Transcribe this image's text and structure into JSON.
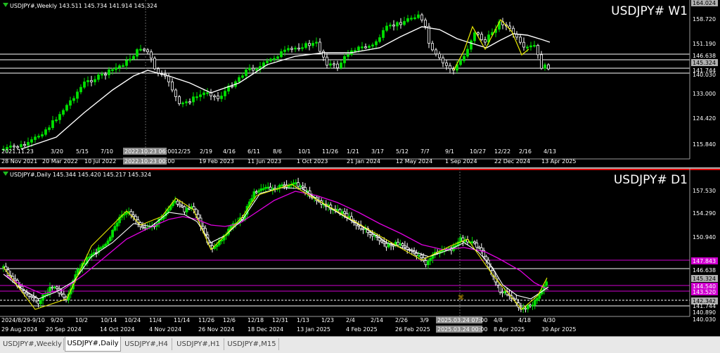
{
  "weekly": {
    "header": "USDJPY#,Weekly  143.511 145.734 141.914 145.324",
    "symbol_label": "USDJPY# W1",
    "price_labels": [
      "164.024",
      "158.720",
      "151.190",
      "146.638",
      "145.324",
      "141.744",
      "140.030",
      "133.000",
      "124.420",
      "115.840"
    ],
    "date_labels": [
      "2021.11.23",
      "28 Nov 2021",
      "3/20",
      "20 Mar 2022",
      "5/15",
      "7/10",
      "10 Jul 2022",
      "2022.10.23 06:00",
      "2022.10.23 00:00",
      "12/25",
      "2/19",
      "19 Feb 2023",
      "4/16",
      "6/11",
      "11 Jun 2023",
      "8/6",
      "10/1",
      "1 Oct 2023",
      "11/26",
      "1/21",
      "21 Jan 2024",
      "3/17",
      "5/12",
      "12 May 2024",
      "7/7",
      "9/1",
      "1 Sep 2024",
      "10/27",
      "12/22",
      "22 Dec 2024",
      "2/16",
      "4/13",
      "13 Apr 2025"
    ]
  },
  "daily": {
    "header": "USDJPY#,Daily  145.344 145.420 145.217 145.324",
    "symbol_label": "USDJPY# D1",
    "price_labels": [
      "157.530",
      "154.290",
      "150.940",
      "147.843",
      "146.638",
      "145.324",
      "144.540",
      "143.520",
      "142.342",
      "141.744",
      "140.890",
      "140.030"
    ],
    "date_labels": [
      "2024/8/29-9/10",
      "29 Aug 2024",
      "9/20",
      "20 Sep 2024",
      "10/2",
      "10/14",
      "14 Oct 2024",
      "10/24",
      "11/4",
      "4 Nov 2024",
      "11/14",
      "11/26",
      "26 Nov 2024",
      "12/6",
      "12/18",
      "18 Dec 2024",
      "12/31",
      "1/13",
      "13 Jan 2025",
      "1/23",
      "2/4",
      "4 Feb 2025",
      "2/14",
      "2/26",
      "26 Feb 2025",
      "3/9",
      "2025.03.24 07:00",
      "2025.03.24 00:00",
      "4/8",
      "8 Apr 2025",
      "4/18",
      "4/30",
      "30 Apr 2025"
    ]
  },
  "tabs": [
    "USDJPY#,Weekly",
    "USDJPY#,Daily",
    "USDJPY#,H4",
    "USDJPY#,H1",
    "USDJPY#,M15"
  ],
  "active_tab": "USDJPY#,Daily",
  "colors": {
    "bull": "#00e000",
    "bear": "#ffffff",
    "ma_white": "#ffffff",
    "ma_magenta": "#e000e0",
    "zigzag": "#e8e800",
    "hline_magenta": "#d000d0"
  }
}
